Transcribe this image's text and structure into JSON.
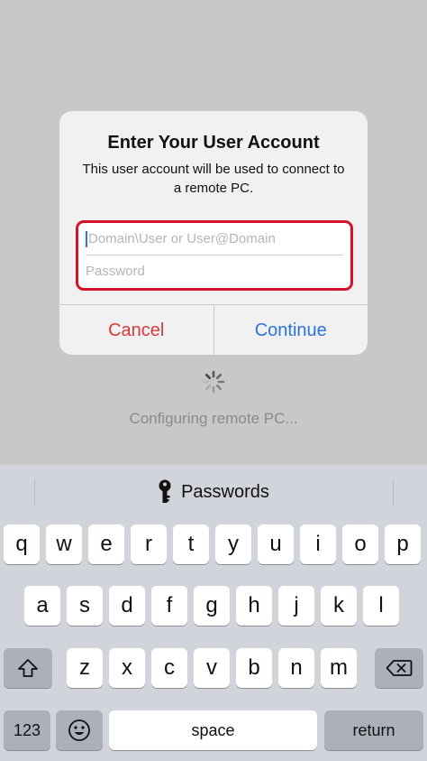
{
  "dialog": {
    "title": "Enter Your User Account",
    "message": "This user account will be used to connect to a remote PC.",
    "username_placeholder": "Domain\\User or User@Domain",
    "password_placeholder": "Password",
    "cancel_label": "Cancel",
    "continue_label": "Continue"
  },
  "status": {
    "text": "Configuring remote PC..."
  },
  "keyboard": {
    "suggestion_label": "Passwords",
    "row1": [
      "q",
      "w",
      "e",
      "r",
      "t",
      "y",
      "u",
      "i",
      "o",
      "p"
    ],
    "row2": [
      "a",
      "s",
      "d",
      "f",
      "g",
      "h",
      "j",
      "k",
      "l"
    ],
    "row3": [
      "z",
      "x",
      "c",
      "v",
      "b",
      "n",
      "m"
    ],
    "numbers_label": "123",
    "space_label": "space",
    "return_label": "return",
    "icons": [
      "key-icon",
      "shift-icon",
      "backspace-icon",
      "emoji-icon"
    ]
  },
  "colors": {
    "highlight_border": "#d6112a",
    "cancel": "#d83a3a",
    "continue": "#2b74d9",
    "caret": "#2f6fd8"
  }
}
